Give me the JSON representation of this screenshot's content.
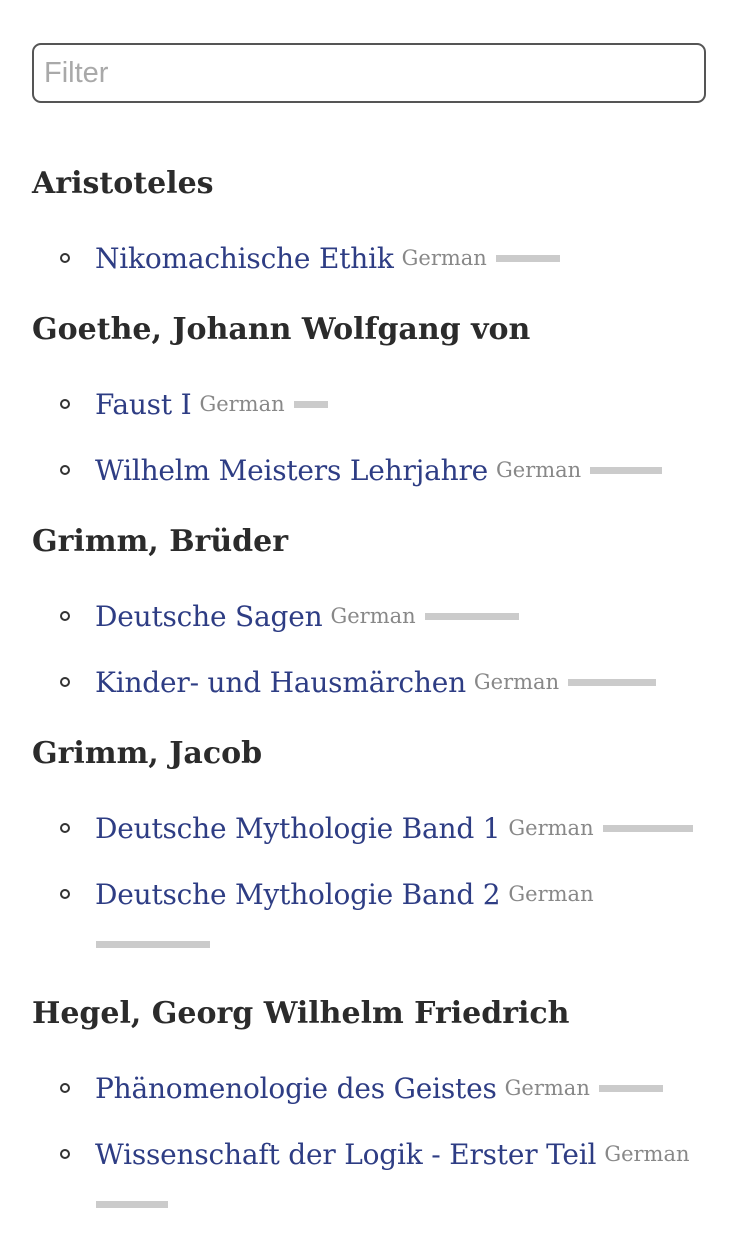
{
  "filter": {
    "placeholder": "Filter",
    "value": ""
  },
  "authors": [
    {
      "name": "Aristoteles",
      "books": [
        {
          "title": "Nikomachische Ethik",
          "language": "German",
          "progress": 0.3
        }
      ]
    },
    {
      "name": "Goethe, Johann Wolfgang von",
      "books": [
        {
          "title": "Faust I",
          "language": "German",
          "progress": 0.15
        },
        {
          "title": "Wilhelm Meisters Lehrjahre",
          "language": "German",
          "progress": 0.33
        }
      ]
    },
    {
      "name": "Grimm, Brüder",
      "books": [
        {
          "title": "Deutsche Sagen",
          "language": "German",
          "progress": 0.43
        },
        {
          "title": "Kinder- und Hausmärchen",
          "language": "German",
          "progress": 0.4
        }
      ]
    },
    {
      "name": "Grimm, Jacob",
      "books": [
        {
          "title": "Deutsche Mythologie Band 1",
          "language": "German",
          "progress": 0.5
        },
        {
          "title": "Deutsche Mythologie Band 2",
          "language": "German",
          "progress": 0.52
        }
      ]
    },
    {
      "name": "Hegel, Georg Wilhelm Friedrich",
      "books": [
        {
          "title": "Phänomenologie des Geistes",
          "language": "German",
          "progress": 0.3
        },
        {
          "title": "Wissenschaft der Logik - Erster Teil",
          "language": "German",
          "progress": 0.33
        }
      ]
    }
  ]
}
